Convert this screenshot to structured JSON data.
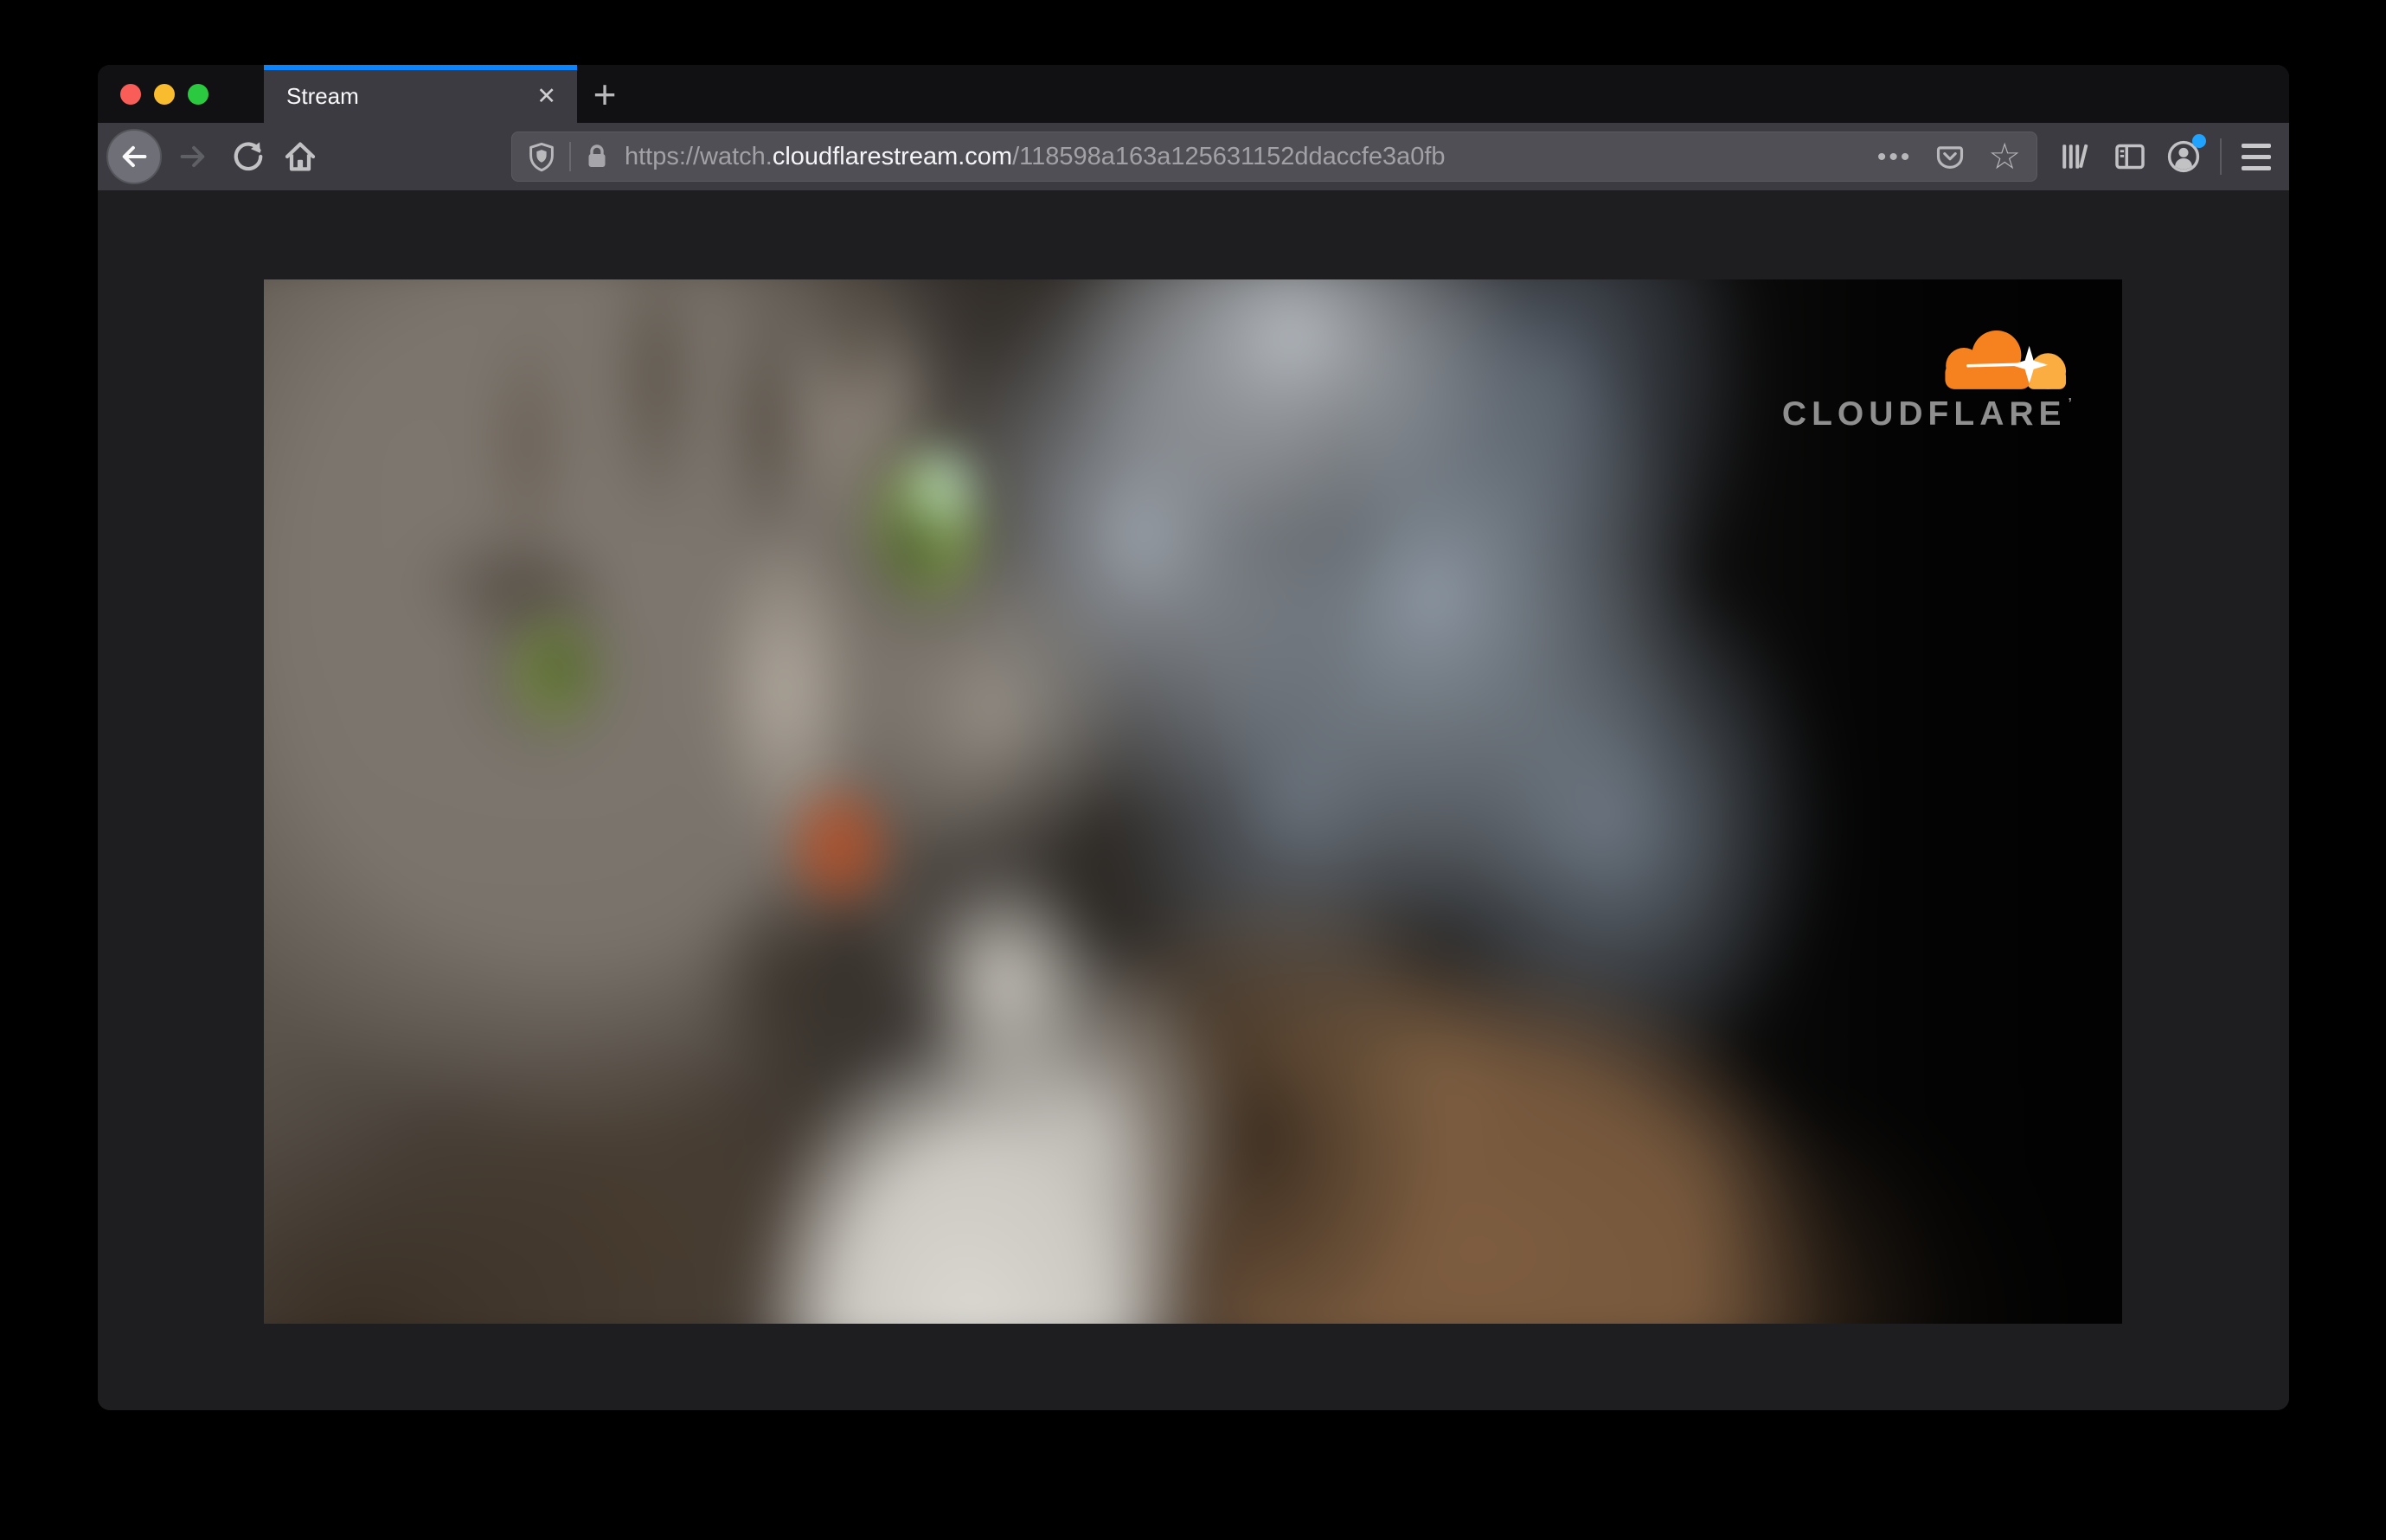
{
  "window": {
    "traffic_lights": {
      "close_color": "#f85e57",
      "minimize_color": "#f8bc2e",
      "zoom_color": "#2bc93f"
    },
    "tab": {
      "title": "Stream"
    },
    "glyphs": {
      "close_tab": "✕",
      "new_tab": "+",
      "page_actions": "•••",
      "bookmark_star": "☆"
    },
    "url_bar": {
      "scheme_and_subdomain": "https://watch.",
      "domain": "cloudflarestream.com",
      "path": "/118598a163a125631152ddaccfe3a0fb"
    },
    "icons": {
      "back": "left-arrow",
      "forward": "right-arrow",
      "refresh": "circular-arrow",
      "home": "house",
      "tracking_protection": "shield",
      "connection_security": "lock",
      "pocket": "pocket-badge",
      "library": "tilted-books",
      "sidebar": "split-panel",
      "account": "person-in-circle",
      "menu": "hamburger"
    },
    "accent_color": "#0a84ff",
    "account_badge_color": "#1fa3ff"
  },
  "video": {
    "brand": {
      "name": "CLOUDFLARE",
      "trademark": "’",
      "cloud_orange": "#f6821f",
      "cloud_light": "#fbad41",
      "text_color": "#8f8f8f"
    }
  }
}
